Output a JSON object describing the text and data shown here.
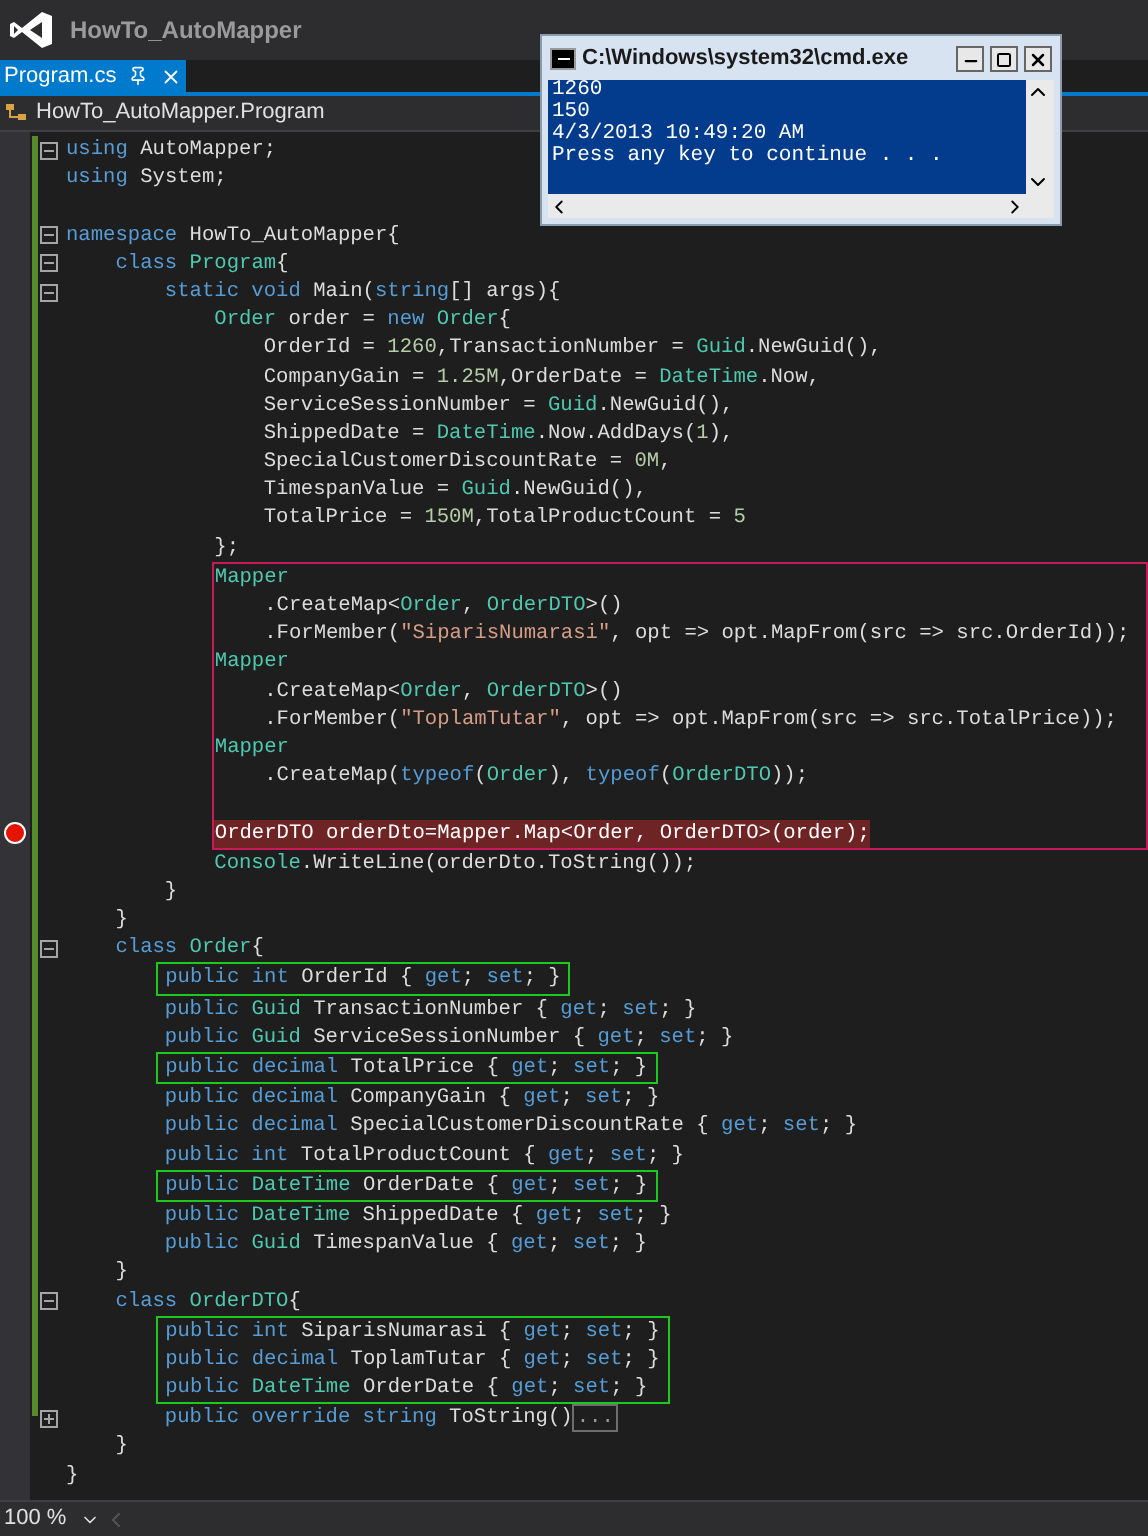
{
  "window": {
    "title": "HowTo_AutoMapper"
  },
  "tabs": [
    {
      "label": "Program.cs",
      "selected": true
    }
  ],
  "navigation": {
    "path": "HowTo_AutoMapper.Program"
  },
  "editor": {
    "blocks": [
      {
        "kind": "plain",
        "lines": [
          {
            "foldable": true,
            "expanded": true,
            "breakpoint": false,
            "tokens": [
              {
                "text": "using",
                "kind": "kw"
              },
              {
                "text": " AutoMapper;",
                "kind": "plain"
              }
            ]
          },
          {
            "foldable": false,
            "breakpoint": false,
            "tokens": [
              {
                "text": "using",
                "kind": "kw"
              },
              {
                "text": " System;",
                "kind": "plain"
              }
            ]
          },
          {
            "foldable": false,
            "breakpoint": false
          },
          {
            "foldable": true,
            "expanded": true,
            "breakpoint": false,
            "tokens": [
              {
                "text": "namespace",
                "kind": "kw"
              },
              {
                "text": " HowTo_AutoMapper{",
                "kind": "plain"
              }
            ]
          },
          {
            "foldable": true,
            "expanded": true,
            "breakpoint": false,
            "tokens": [
              {
                "text": "    class ",
                "kind": "kw"
              },
              {
                "text": "Program",
                "kind": "type"
              },
              {
                "text": "{",
                "kind": "plain"
              }
            ]
          },
          {
            "foldable": true,
            "expanded": true,
            "breakpoint": false,
            "tokens": [
              {
                "text": "        static void",
                "kind": "kw"
              },
              {
                "text": " Main(",
                "kind": "plain"
              },
              {
                "text": "string",
                "kind": "kw"
              },
              {
                "text": "[] args){",
                "kind": "plain"
              }
            ]
          },
          {
            "foldable": false,
            "breakpoint": false,
            "tokens": [
              {
                "text": "            Order",
                "kind": "type"
              },
              {
                "text": " order = ",
                "kind": "plain"
              },
              {
                "text": "new ",
                "kind": "kw"
              },
              {
                "text": "Order",
                "kind": "type"
              },
              {
                "text": "{",
                "kind": "plain"
              }
            ]
          },
          {
            "foldable": false,
            "breakpoint": false,
            "tokens": [
              {
                "text": "                OrderId = ",
                "kind": "plain"
              },
              {
                "text": "1260",
                "kind": "num"
              },
              {
                "text": ",TransactionNumber = ",
                "kind": "plain"
              },
              {
                "text": "Guid",
                "kind": "type"
              },
              {
                "text": ".NewGuid(),",
                "kind": "plain"
              }
            ]
          },
          {
            "foldable": false,
            "breakpoint": false,
            "tokens": [
              {
                "text": "                CompanyGain = ",
                "kind": "plain"
              },
              {
                "text": "1.25M",
                "kind": "num"
              },
              {
                "text": ",OrderDate = ",
                "kind": "plain"
              },
              {
                "text": "DateTime",
                "kind": "type"
              },
              {
                "text": ".Now,",
                "kind": "plain"
              }
            ]
          },
          {
            "foldable": false,
            "breakpoint": false,
            "tokens": [
              {
                "text": "                ServiceSessionNumber = ",
                "kind": "plain"
              },
              {
                "text": "Guid",
                "kind": "type"
              },
              {
                "text": ".NewGuid(),",
                "kind": "plain"
              }
            ]
          },
          {
            "foldable": false,
            "breakpoint": false,
            "tokens": [
              {
                "text": "                ShippedDate = ",
                "kind": "plain"
              },
              {
                "text": "DateTime",
                "kind": "type"
              },
              {
                "text": ".Now.AddDays(",
                "kind": "plain"
              },
              {
                "text": "1",
                "kind": "num"
              },
              {
                "text": "),",
                "kind": "plain"
              }
            ]
          },
          {
            "foldable": false,
            "breakpoint": false,
            "tokens": [
              {
                "text": "                SpecialCustomerDiscountRate = ",
                "kind": "plain"
              },
              {
                "text": "0M",
                "kind": "num"
              },
              {
                "text": ",",
                "kind": "plain"
              }
            ]
          },
          {
            "foldable": false,
            "breakpoint": false,
            "tokens": [
              {
                "text": "                TimespanValue = ",
                "kind": "plain"
              },
              {
                "text": "Guid",
                "kind": "type"
              },
              {
                "text": ".NewGuid(),",
                "kind": "plain"
              }
            ]
          },
          {
            "foldable": false,
            "breakpoint": false,
            "tokens": [
              {
                "text": "                TotalPrice = ",
                "kind": "plain"
              },
              {
                "text": "150M",
                "kind": "num"
              },
              {
                "text": ",TotalProductCount = ",
                "kind": "plain"
              },
              {
                "text": "5",
                "kind": "num"
              }
            ]
          },
          {
            "foldable": false,
            "breakpoint": false,
            "tokens": [
              {
                "text": "            };",
                "kind": "plain"
              }
            ]
          }
        ]
      },
      {
        "kind": "red-box",
        "lines": [
          {
            "foldable": false,
            "breakpoint": false,
            "tokens": [
              {
                "text": "            Mapper",
                "kind": "type"
              }
            ]
          },
          {
            "foldable": false,
            "breakpoint": false,
            "tokens": [
              {
                "text": "                .CreateMap<",
                "kind": "plain"
              },
              {
                "text": "Order",
                "kind": "type"
              },
              {
                "text": ", ",
                "kind": "plain"
              },
              {
                "text": "OrderDTO",
                "kind": "type"
              },
              {
                "text": ">()",
                "kind": "plain"
              }
            ]
          },
          {
            "foldable": false,
            "breakpoint": false,
            "tokens": [
              {
                "text": "                .ForMember(",
                "kind": "plain"
              },
              {
                "text": "\"SiparisNumarasi\"",
                "kind": "str"
              },
              {
                "text": ", opt => opt.MapFrom(src => src.OrderId));",
                "kind": "plain"
              }
            ]
          },
          {
            "foldable": false,
            "breakpoint": false,
            "tokens": [
              {
                "text": "            Mapper",
                "kind": "type"
              }
            ]
          },
          {
            "foldable": false,
            "breakpoint": false,
            "tokens": [
              {
                "text": "                .CreateMap<",
                "kind": "plain"
              },
              {
                "text": "Order",
                "kind": "type"
              },
              {
                "text": ", ",
                "kind": "plain"
              },
              {
                "text": "OrderDTO",
                "kind": "type"
              },
              {
                "text": ">()",
                "kind": "plain"
              }
            ]
          },
          {
            "foldable": false,
            "breakpoint": false,
            "tokens": [
              {
                "text": "                .ForMember(",
                "kind": "plain"
              },
              {
                "text": "\"ToplamTutar\"",
                "kind": "str"
              },
              {
                "text": ", opt => opt.MapFrom(src => src.TotalPrice));",
                "kind": "plain"
              }
            ]
          },
          {
            "foldable": false,
            "breakpoint": false,
            "tokens": [
              {
                "text": "            Mapper",
                "kind": "type"
              }
            ]
          },
          {
            "foldable": false,
            "breakpoint": false,
            "tokens": [
              {
                "text": "                .CreateMap(",
                "kind": "plain"
              },
              {
                "text": "typeof",
                "kind": "kw"
              },
              {
                "text": "(",
                "kind": "plain"
              },
              {
                "text": "Order",
                "kind": "type"
              },
              {
                "text": "), ",
                "kind": "plain"
              },
              {
                "text": "typeof",
                "kind": "kw"
              },
              {
                "text": "(",
                "kind": "plain"
              },
              {
                "text": "OrderDTO",
                "kind": "type"
              },
              {
                "text": "));",
                "kind": "plain"
              }
            ]
          },
          {
            "foldable": false,
            "breakpoint": false
          },
          {
            "foldable": false,
            "breakpoint": true,
            "tokens": [
              {
                "text": "            OrderDTO orderDto=Mapper.Map<Order, OrderDTO>(order);",
                "kind": "plain"
              }
            ]
          }
        ]
      },
      {
        "kind": "plain",
        "lines": [
          {
            "foldable": false,
            "breakpoint": false,
            "tokens": [
              {
                "text": "            Console",
                "kind": "type"
              },
              {
                "text": ".WriteLine(orderDto.ToString());",
                "kind": "plain"
              }
            ]
          },
          {
            "foldable": false,
            "breakpoint": false,
            "tokens": [
              {
                "text": "        }",
                "kind": "plain"
              }
            ]
          },
          {
            "foldable": false,
            "breakpoint": false,
            "tokens": [
              {
                "text": "    }",
                "kind": "plain"
              }
            ]
          },
          {
            "foldable": true,
            "expanded": true,
            "breakpoint": false,
            "tokens": [
              {
                "text": "    class ",
                "kind": "kw"
              },
              {
                "text": "Order",
                "kind": "type"
              },
              {
                "text": "{",
                "kind": "plain"
              }
            ]
          }
        ]
      },
      {
        "kind": "green-box",
        "lines": [
          {
            "foldable": false,
            "breakpoint": false,
            "tokens": [
              {
                "text": "        public int",
                "kind": "kw"
              },
              {
                "text": " OrderId { ",
                "kind": "plain"
              },
              {
                "text": "get",
                "kind": "kw"
              },
              {
                "text": "; ",
                "kind": "plain"
              },
              {
                "text": "set",
                "kind": "kw"
              },
              {
                "text": "; }",
                "kind": "plain"
              }
            ]
          }
        ]
      },
      {
        "kind": "plain",
        "lines": [
          {
            "foldable": false,
            "breakpoint": false,
            "tokens": [
              {
                "text": "        public ",
                "kind": "kw"
              },
              {
                "text": "Guid",
                "kind": "type"
              },
              {
                "text": " TransactionNumber { ",
                "kind": "plain"
              },
              {
                "text": "get",
                "kind": "kw"
              },
              {
                "text": "; ",
                "kind": "plain"
              },
              {
                "text": "set",
                "kind": "kw"
              },
              {
                "text": "; }",
                "kind": "plain"
              }
            ]
          },
          {
            "foldable": false,
            "breakpoint": false,
            "tokens": [
              {
                "text": "        public ",
                "kind": "kw"
              },
              {
                "text": "Guid",
                "kind": "type"
              },
              {
                "text": " ServiceSessionNumber { ",
                "kind": "plain"
              },
              {
                "text": "get",
                "kind": "kw"
              },
              {
                "text": "; ",
                "kind": "plain"
              },
              {
                "text": "set",
                "kind": "kw"
              },
              {
                "text": "; }",
                "kind": "plain"
              }
            ]
          }
        ]
      },
      {
        "kind": "green-box",
        "lines": [
          {
            "foldable": false,
            "breakpoint": false,
            "tokens": [
              {
                "text": "        public decimal",
                "kind": "kw"
              },
              {
                "text": " TotalPrice { ",
                "kind": "plain"
              },
              {
                "text": "get",
                "kind": "kw"
              },
              {
                "text": "; ",
                "kind": "plain"
              },
              {
                "text": "set",
                "kind": "kw"
              },
              {
                "text": "; }",
                "kind": "plain"
              }
            ]
          }
        ]
      },
      {
        "kind": "plain",
        "lines": [
          {
            "foldable": false,
            "breakpoint": false,
            "tokens": [
              {
                "text": "        public decimal",
                "kind": "kw"
              },
              {
                "text": " CompanyGain { ",
                "kind": "plain"
              },
              {
                "text": "get",
                "kind": "kw"
              },
              {
                "text": "; ",
                "kind": "plain"
              },
              {
                "text": "set",
                "kind": "kw"
              },
              {
                "text": "; }",
                "kind": "plain"
              }
            ]
          },
          {
            "foldable": false,
            "breakpoint": false,
            "tokens": [
              {
                "text": "        public decimal",
                "kind": "kw"
              },
              {
                "text": " SpecialCustomerDiscountRate { ",
                "kind": "plain"
              },
              {
                "text": "get",
                "kind": "kw"
              },
              {
                "text": "; ",
                "kind": "plain"
              },
              {
                "text": "set",
                "kind": "kw"
              },
              {
                "text": "; }",
                "kind": "plain"
              }
            ]
          },
          {
            "foldable": false,
            "breakpoint": false,
            "tokens": [
              {
                "text": "        public int",
                "kind": "kw"
              },
              {
                "text": " TotalProductCount { ",
                "kind": "plain"
              },
              {
                "text": "get",
                "kind": "kw"
              },
              {
                "text": "; ",
                "kind": "plain"
              },
              {
                "text": "set",
                "kind": "kw"
              },
              {
                "text": "; }",
                "kind": "plain"
              }
            ]
          }
        ]
      },
      {
        "kind": "green-box",
        "lines": [
          {
            "foldable": false,
            "breakpoint": false,
            "tokens": [
              {
                "text": "        public ",
                "kind": "kw"
              },
              {
                "text": "DateTime",
                "kind": "type"
              },
              {
                "text": " OrderDate { ",
                "kind": "plain"
              },
              {
                "text": "get",
                "kind": "kw"
              },
              {
                "text": "; ",
                "kind": "plain"
              },
              {
                "text": "set",
                "kind": "kw"
              },
              {
                "text": "; }",
                "kind": "plain"
              }
            ]
          }
        ]
      },
      {
        "kind": "plain",
        "lines": [
          {
            "foldable": false,
            "breakpoint": false,
            "tokens": [
              {
                "text": "        public ",
                "kind": "kw"
              },
              {
                "text": "DateTime",
                "kind": "type"
              },
              {
                "text": " ShippedDate { ",
                "kind": "plain"
              },
              {
                "text": "get",
                "kind": "kw"
              },
              {
                "text": "; ",
                "kind": "plain"
              },
              {
                "text": "set",
                "kind": "kw"
              },
              {
                "text": "; }",
                "kind": "plain"
              }
            ]
          },
          {
            "foldable": false,
            "breakpoint": false,
            "tokens": [
              {
                "text": "        public ",
                "kind": "kw"
              },
              {
                "text": "Guid",
                "kind": "type"
              },
              {
                "text": " TimespanValue { ",
                "kind": "plain"
              },
              {
                "text": "get",
                "kind": "kw"
              },
              {
                "text": "; ",
                "kind": "plain"
              },
              {
                "text": "set",
                "kind": "kw"
              },
              {
                "text": "; }",
                "kind": "plain"
              }
            ]
          },
          {
            "foldable": false,
            "breakpoint": false,
            "tokens": [
              {
                "text": "    }",
                "kind": "plain"
              }
            ]
          },
          {
            "foldable": true,
            "expanded": true,
            "breakpoint": false,
            "tokens": [
              {
                "text": "    class ",
                "kind": "kw"
              },
              {
                "text": "OrderDTO",
                "kind": "type"
              },
              {
                "text": "{",
                "kind": "plain"
              }
            ]
          }
        ]
      },
      {
        "kind": "green-box",
        "lines": [
          {
            "foldable": false,
            "breakpoint": false,
            "tokens": [
              {
                "text": "        public int",
                "kind": "kw"
              },
              {
                "text": " SiparisNumarasi { ",
                "kind": "plain"
              },
              {
                "text": "get",
                "kind": "kw"
              },
              {
                "text": "; ",
                "kind": "plain"
              },
              {
                "text": "set",
                "kind": "kw"
              },
              {
                "text": "; }",
                "kind": "plain"
              }
            ]
          },
          {
            "foldable": false,
            "breakpoint": false,
            "tokens": [
              {
                "text": "        public decimal",
                "kind": "kw"
              },
              {
                "text": " ToplamTutar { ",
                "kind": "plain"
              },
              {
                "text": "get",
                "kind": "kw"
              },
              {
                "text": "; ",
                "kind": "plain"
              },
              {
                "text": "set",
                "kind": "kw"
              },
              {
                "text": "; }",
                "kind": "plain"
              }
            ]
          },
          {
            "foldable": false,
            "breakpoint": false,
            "tokens": [
              {
                "text": "        public ",
                "kind": "kw"
              },
              {
                "text": "DateTime",
                "kind": "type"
              },
              {
                "text": " OrderDate { ",
                "kind": "plain"
              },
              {
                "text": "get",
                "kind": "kw"
              },
              {
                "text": "; ",
                "kind": "plain"
              },
              {
                "text": "set",
                "kind": "kw"
              },
              {
                "text": "; }",
                "kind": "plain"
              }
            ]
          }
        ]
      },
      {
        "kind": "plain",
        "lines": [
          {
            "foldable": true,
            "expanded": false,
            "breakpoint": false,
            "tokens": [
              {
                "text": "        public override string",
                "kind": "kw"
              },
              {
                "text": " ToString()",
                "kind": "plain"
              },
              {
                "text": "...",
                "kind": "collapsed"
              }
            ]
          },
          {
            "foldable": false,
            "breakpoint": false,
            "tokens": [
              {
                "text": "    }",
                "kind": "plain"
              }
            ]
          },
          {
            "foldable": false,
            "breakpoint": false,
            "tokens": [
              {
                "text": "}",
                "kind": "plain"
              }
            ]
          }
        ]
      }
    ]
  },
  "console": {
    "title": "C:\\Windows\\system32\\cmd.exe",
    "lines": [
      "1260",
      "150",
      "4/3/2013 10:49:20 AM",
      "Press any key to continue . . ."
    ]
  },
  "status_bar": {
    "zoom": "100 %"
  }
}
